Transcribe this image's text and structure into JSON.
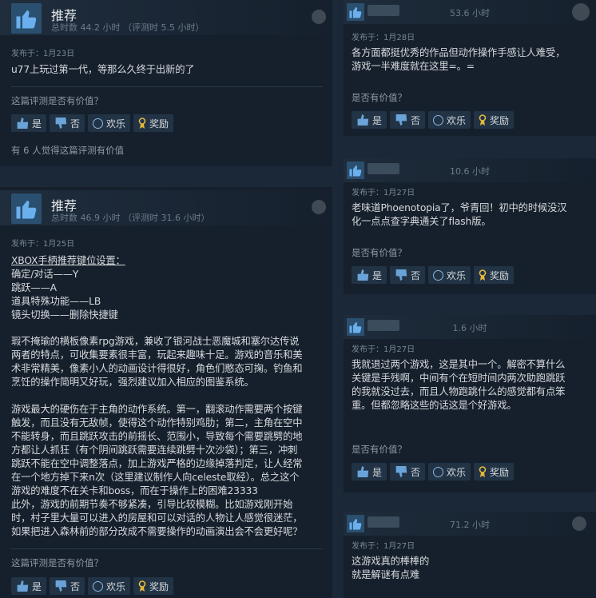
{
  "colors": {
    "background": "#1b2838",
    "card": "#16202d",
    "button": "#213345",
    "accent": "#6aa3d8"
  },
  "left": {
    "review1": {
      "title": "推荐",
      "hours": "总时数 44.2 小时 （评测时 5.5 小时）",
      "date": "发布于：1月23日",
      "text": "u77上玩过第一代，等那么久终于出新的了",
      "helpful_q": "这篇评测是否有价值？",
      "btn_yes": "是",
      "btn_no": "否",
      "btn_funny": "欢乐",
      "btn_award": "奖励",
      "found": "有 6 人觉得这篇评测有价值"
    },
    "review2": {
      "title": "推荐",
      "hours": "总时数 46.9 小时 （评测时 31.6 小时）",
      "date": "发布于：1月25日",
      "heading": "XBOX手柄推荐键位设置：",
      "keys": "确定/对话——Y\n跳跃——A\n道具特殊功能——LB\n镜头切换——删除快捷键",
      "para1": "瑕不掩瑜的横板像素rpg游戏，兼收了银河战士恶魔城和塞尔达传说\n两者的特点，可收集要素很丰富，玩起来趣味十足。游戏的音乐和美\n术非常精美，像素小人的动画设计得很好，角色们憨态可掬。钓鱼和\n烹饪的操作简明又好玩，强烈建议加入相应的图鉴系统。",
      "para2": "游戏最大的硬伤在于主角的动作系统。第一，翻滚动作需要两个按键\n触发，而且没有无敌帧，使得这个动作特别鸡肋；第二，主角在空中\n不能转身，而且跳跃攻击的前摇长、范围小，导致每个需要跳劈的地\n方都让人抓狂（有个阴间跳跃需要连续跳劈十次沙袋）；第三，冲刺\n跳跃不能在空中调整落点，加上游戏严格的边缘掉落判定，让人经常\n在一个地方掉下来n次（这里建议制作人向celeste取经）。总之这个\n游戏的难度不在关卡和boss，而在于操作上的困难23333\n此外，游戏的前期节奏不够紧凑，引导比较模糊。比如游戏刚开始\n时，村子里大量可以进入的房屋和可以对话的人物让人感觉很迷茫，\n如果把进入森林前的部分改成不需要操作的动画演出会不会更好呢？",
      "helpful_q": "这篇评测是否有价值？",
      "btn_yes": "是",
      "btn_no": "否",
      "btn_funny": "欢乐",
      "btn_award": "奖励"
    }
  },
  "right": {
    "r1": {
      "hours": "53.6 小时",
      "date": "发布于：1月28日",
      "text": "各方面都挺优秀的作品但动作操作手感让人难受，\n游戏一半难度就在这里=。=",
      "q": "是否有价值？",
      "yes": "是",
      "no": "否",
      "funny": "欢乐",
      "award": "奖励"
    },
    "r2": {
      "hours": "10.6 小时",
      "date": "发布于：1月27日",
      "text": "老味道Phoenotopia了，爷青回！初中的时候没汉\n化一点点查字典通关了flash版。",
      "q": "是否有价值？",
      "yes": "是",
      "no": "否",
      "funny": "欢乐",
      "award": "奖励"
    },
    "r3": {
      "hours": "1.6 小时",
      "date": "发布于：1月27日",
      "text": "我就退过两个游戏，这是其中一个。解密不算什么\n关键是手残啊，中间有个在短时间内两次助跑跳跃\n的我就没过去，而且人物跑跳什么的感觉都有点笨\n重。但都忽略这些的话这是个好游戏。",
      "q": "是否有价值？",
      "yes": "是",
      "no": "否",
      "funny": "欢乐",
      "award": "奖励"
    },
    "r4": {
      "hours": "71.2 小时",
      "date": "发布于：1月27日",
      "text": "这游戏真的棒棒的\n就是解谜有点难"
    }
  }
}
